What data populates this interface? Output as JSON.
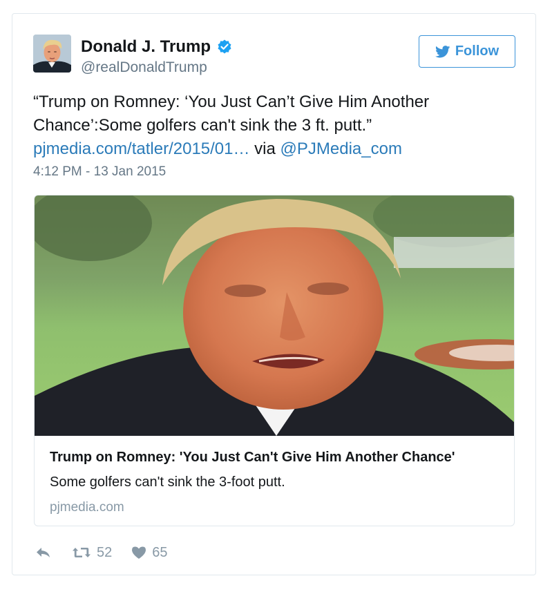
{
  "user": {
    "name": "Donald J. Trump",
    "handle": "@realDonaldTrump",
    "verified": true
  },
  "follow_button": {
    "label": "Follow",
    "icon": "twitter-bird-icon"
  },
  "tweet": {
    "text_line1": "“Trump on Romney: ‘You Just Can’t Give Him Another",
    "text_line2": "Chance’:Some golfers can't sink the 3 ft. putt.”",
    "link_text": "pjmedia.com/tatler/2015/01…",
    "via_text": " via ",
    "mention": "@PJMedia_com",
    "timestamp": "4:12 PM - 13 Jan 2015"
  },
  "card": {
    "title": "Trump on Romney: 'You Just Can't Give Him Another Chance'",
    "description": "Some golfers can't sink the 3-foot putt.",
    "domain": "pjmedia.com"
  },
  "actions": {
    "reply_icon": "reply-icon",
    "retweet_icon": "retweet-icon",
    "retweet_count": "52",
    "like_icon": "heart-icon",
    "like_count": "65"
  },
  "colors": {
    "link": "#2b7bb9",
    "follow": "#3b94d9",
    "verified": "#1da1f2",
    "muted": "#657786",
    "border": "#e1e8ed"
  }
}
